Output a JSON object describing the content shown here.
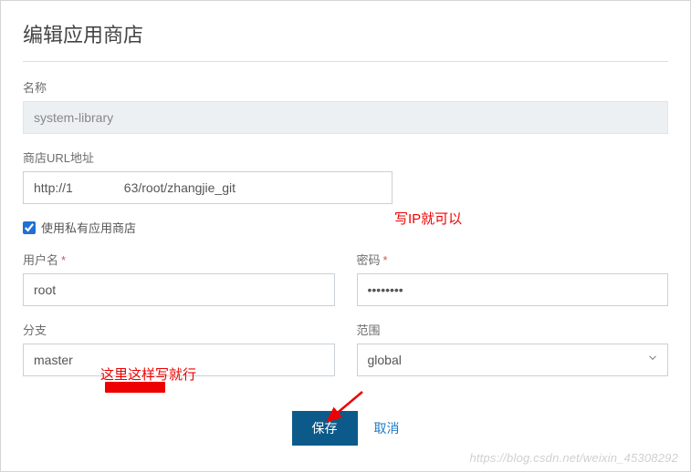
{
  "dialog": {
    "title": "编辑应用商店",
    "name_label": "名称",
    "name_value": "system-library",
    "url_label": "商店URL地址",
    "url_value": "http://1　　　　63/root/zhangjie_git",
    "private_checkbox_label": "使用私有应用商店",
    "username_label": "用户名",
    "username_value": "root",
    "password_label": "密码",
    "password_value": "••••••••",
    "branch_label": "分支",
    "branch_value": "master",
    "scope_label": "范围",
    "scope_value": "global",
    "save_label": "保存",
    "cancel_label": "取消"
  },
  "annotations": {
    "ip_note": "写IP就可以",
    "branch_note": "这里这样写就行"
  },
  "watermark": "https://blog.csdn.net/weixin_45308292"
}
